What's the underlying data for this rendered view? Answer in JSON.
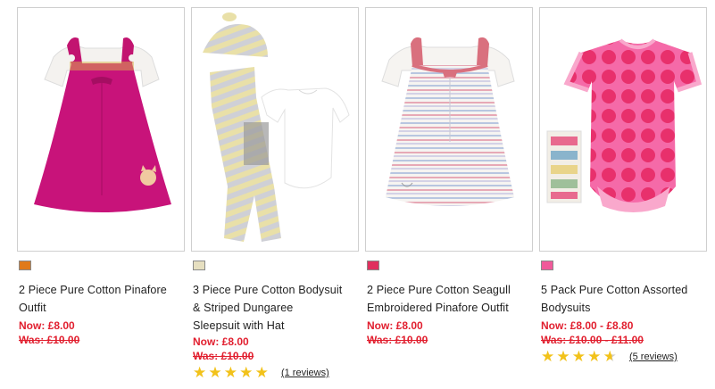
{
  "products": [
    {
      "title_line1": "2 Piece Pure Cotton Pinafore",
      "title_line2": "Outfit",
      "title_line3": "",
      "swatch_color": "#e07a1a",
      "now_price": "Now: £8.00",
      "was_price": "Was: £10.00",
      "image_icon": "pink-pinafore-dress-image"
    },
    {
      "title_line1": "3 Piece Pure Cotton Bodysuit",
      "title_line2": "& Striped Dungaree",
      "title_line3": "Sleepsuit with Hat",
      "swatch_color": "#e6dfc0",
      "now_price": "Now: £8.00",
      "was_price": "Was: £10.00",
      "rating": 5,
      "reviews": "(1 reviews)",
      "image_icon": "striped-sleepsuit-hat-image"
    },
    {
      "title_line1": "2 Piece Pure Cotton Seagull",
      "title_line2": "Embroidered Pinafore Outfit",
      "title_line3": "",
      "swatch_color": "#e0305e",
      "now_price": "Now: £8.00",
      "was_price": "Was: £10.00",
      "image_icon": "striped-pinafore-dress-image"
    },
    {
      "title_line1": "5 Pack Pure Cotton Assorted",
      "title_line2": "Bodysuits",
      "title_line3": "",
      "swatch_color": "#f05a9a",
      "now_price": "Now: £8.00 - £8.80",
      "was_price": "Was: £10.00 - £11.00",
      "rating": 4.5,
      "reviews": "(5 reviews)",
      "image_icon": "polka-dot-bodysuit-image"
    }
  ],
  "colors": {
    "price_red": "#e11e2e",
    "star_gold": "#f2c21a",
    "border": "#cfcfcf"
  }
}
